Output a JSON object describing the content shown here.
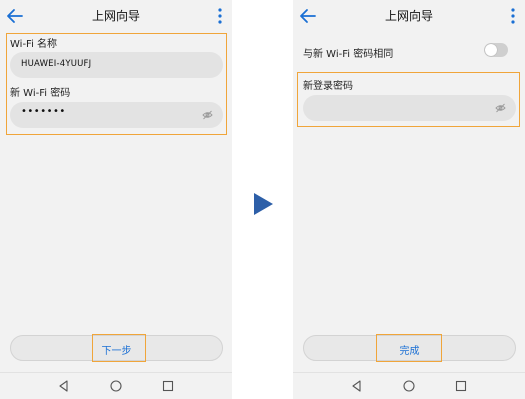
{
  "colors": {
    "accent": "#1a6fd4",
    "highlight": "#f0a53a",
    "arrow": "#2d5fa8",
    "screen_bg": "#f2f2f2",
    "input_bg": "#e3e3e3"
  },
  "left_screen": {
    "app_bar": {
      "title": "上网向导",
      "back_icon": "back-arrow-icon",
      "menu_icon": "more-vert-icon"
    },
    "wifi_name": {
      "label": "Wi-Fi 名称",
      "value": "HUAWEI-4YUUFJ"
    },
    "wifi_password": {
      "label": "新 Wi-Fi 密码",
      "value": "•••••••",
      "icon": "eye-icon"
    },
    "next_button": {
      "label": "下一步"
    },
    "nav": {
      "back": "nav-back-icon",
      "home": "nav-home-icon",
      "recents": "nav-recents-icon"
    }
  },
  "transition_icon": "play-arrow-icon",
  "right_screen": {
    "app_bar": {
      "title": "上网向导",
      "back_icon": "back-arrow-icon",
      "menu_icon": "more-vert-icon"
    },
    "same_password_toggle": {
      "label": "与新 Wi-Fi 密码相同",
      "state": "off"
    },
    "login_password": {
      "label": "新登录密码",
      "value": "",
      "icon": "eye-icon"
    },
    "finish_button": {
      "label": "完成"
    },
    "nav": {
      "back": "nav-back-icon",
      "home": "nav-home-icon",
      "recents": "nav-recents-icon"
    }
  }
}
